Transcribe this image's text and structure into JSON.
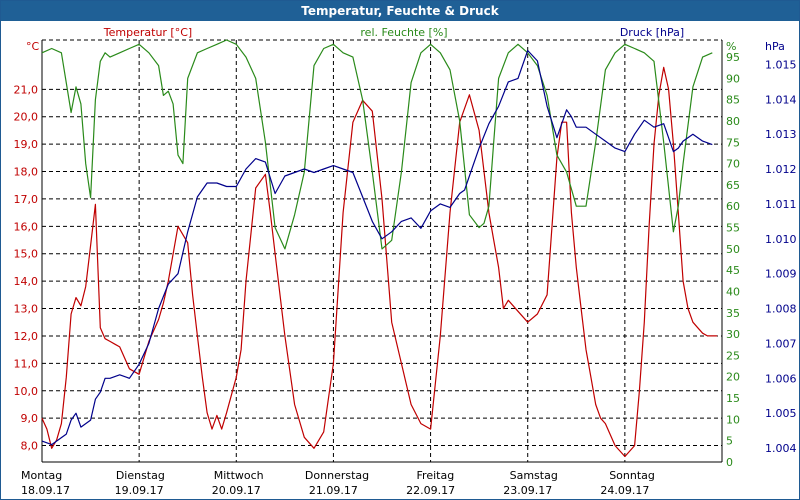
{
  "chart_data": {
    "type": "line",
    "title": "Temperatur, Feuchte & Druck",
    "x_categories": [
      {
        "day": "Montag",
        "date": "18.09.17"
      },
      {
        "day": "Dienstag",
        "date": "19.09.17"
      },
      {
        "day": "Mittwoch",
        "date": "20.09.17"
      },
      {
        "day": "Donnerstag",
        "date": "21.09.17"
      },
      {
        "day": "Freitag",
        "date": "22.09.17"
      },
      {
        "day": "Samstag",
        "date": "23.09.17"
      },
      {
        "day": "Sonntag",
        "date": "24.09.17"
      }
    ],
    "x_range_days": [
      0,
      7
    ],
    "grid": true,
    "axes": {
      "temperature": {
        "label": "Temperatur [°C]",
        "unit": "°C",
        "min": 7.4,
        "max": 22.8,
        "ticks": [
          "8,0",
          "9,0",
          "10,0",
          "11,0",
          "12,0",
          "13,0",
          "14,0",
          "15,0",
          "16,0",
          "17,0",
          "18,0",
          "19,0",
          "20,0",
          "21,0"
        ],
        "tick_values": [
          8,
          9,
          10,
          11,
          12,
          13,
          14,
          15,
          16,
          17,
          18,
          19,
          20,
          21
        ],
        "color": "#c00000"
      },
      "humidity": {
        "label": "rel. Feuchte [%]",
        "unit": "%",
        "min": 0,
        "max": 99,
        "ticks": [
          "0",
          "5",
          "10",
          "15",
          "20",
          "25",
          "30",
          "35",
          "40",
          "45",
          "50",
          "55",
          "60",
          "65",
          "70",
          "75",
          "80",
          "85",
          "90",
          "95"
        ],
        "tick_values": [
          0,
          5,
          10,
          15,
          20,
          25,
          30,
          35,
          40,
          45,
          50,
          55,
          60,
          65,
          70,
          75,
          80,
          85,
          90,
          95
        ],
        "color": "#2a8a1a"
      },
      "pressure": {
        "label": "Druck [hPa]",
        "unit": "hPa",
        "min": 1003.6,
        "max": 1015.7,
        "ticks": [
          "1.004",
          "1.005",
          "1.006",
          "1.007",
          "1.008",
          "1.009",
          "1.010",
          "1.011",
          "1.012",
          "1.013",
          "1.014",
          "1.015"
        ],
        "tick_values": [
          1004,
          1005,
          1006,
          1007,
          1008,
          1009,
          1010,
          1011,
          1012,
          1013,
          1014,
          1015
        ],
        "color": "#00008b"
      }
    },
    "series": [
      {
        "name": "Temperatur [°C]",
        "axis": "temperature",
        "color": "#c00000",
        "x": [
          0,
          0.05,
          0.1,
          0.15,
          0.2,
          0.25,
          0.3,
          0.35,
          0.4,
          0.45,
          0.5,
          0.55,
          0.6,
          0.65,
          0.7,
          0.75,
          0.8,
          0.9,
          1.0,
          1.1,
          1.2,
          1.25,
          1.3,
          1.4,
          1.5,
          1.55,
          1.6,
          1.65,
          1.7,
          1.75,
          1.8,
          1.85,
          1.9,
          2.0,
          2.05,
          2.1,
          2.2,
          2.3,
          2.35,
          2.4,
          2.5,
          2.6,
          2.7,
          2.8,
          2.9,
          3.0,
          3.1,
          3.2,
          3.3,
          3.4,
          3.5,
          3.6,
          3.7,
          3.8,
          3.9,
          4.0,
          4.1,
          4.2,
          4.3,
          4.4,
          4.5,
          4.6,
          4.65,
          4.7,
          4.75,
          4.8,
          4.9,
          5.0,
          5.1,
          5.2,
          5.3,
          5.35,
          5.4,
          5.45,
          5.5,
          5.55,
          5.6,
          5.65,
          5.7,
          5.75,
          5.8,
          5.9,
          6.0,
          6.1,
          6.15,
          6.2,
          6.25,
          6.3,
          6.35,
          6.4,
          6.45,
          6.5,
          6.55,
          6.6,
          6.65,
          6.7,
          6.75,
          6.8,
          6.85,
          6.9,
          6.95
        ],
        "y": [
          9.0,
          8.6,
          7.9,
          8.2,
          8.8,
          10.5,
          12.8,
          13.4,
          13.1,
          13.8,
          15.3,
          16.8,
          12.3,
          11.9,
          11.8,
          11.7,
          11.6,
          10.8,
          10.6,
          11.8,
          12.6,
          13.2,
          14.0,
          16.0,
          15.4,
          13.5,
          12.0,
          10.5,
          9.2,
          8.6,
          9.1,
          8.6,
          9.2,
          10.5,
          11.5,
          14.0,
          17.4,
          17.9,
          16.5,
          15.0,
          12.0,
          9.5,
          8.3,
          7.9,
          8.5,
          11.0,
          16.5,
          19.8,
          20.6,
          20.2,
          17.0,
          12.5,
          11.0,
          9.5,
          8.8,
          8.6,
          12.0,
          16.5,
          19.8,
          20.8,
          19.5,
          16.5,
          15.5,
          14.5,
          13.0,
          13.3,
          12.9,
          12.5,
          12.8,
          13.5,
          18.5,
          19.8,
          19.8,
          16.5,
          14.5,
          13.0,
          11.5,
          10.5,
          9.5,
          9.0,
          8.8,
          8.0,
          7.6,
          8.0,
          10.0,
          12.5,
          16.0,
          19.0,
          20.8,
          21.8,
          21.0,
          19.0,
          16.5,
          14.0,
          13.0,
          12.5,
          12.3,
          12.1,
          12.0,
          12.0,
          12.0
        ]
      },
      {
        "name": "rel. Feuchte [%]",
        "axis": "humidity",
        "color": "#2a8a1a",
        "x": [
          0,
          0.1,
          0.2,
          0.3,
          0.35,
          0.4,
          0.45,
          0.5,
          0.55,
          0.6,
          0.65,
          0.7,
          0.8,
          0.9,
          1.0,
          1.1,
          1.2,
          1.25,
          1.3,
          1.35,
          1.4,
          1.45,
          1.5,
          1.6,
          1.7,
          1.8,
          1.9,
          2.0,
          2.1,
          2.2,
          2.3,
          2.4,
          2.5,
          2.6,
          2.7,
          2.8,
          2.9,
          3.0,
          3.1,
          3.2,
          3.3,
          3.4,
          3.5,
          3.6,
          3.7,
          3.8,
          3.9,
          4.0,
          4.1,
          4.2,
          4.3,
          4.4,
          4.5,
          4.55,
          4.6,
          4.65,
          4.7,
          4.8,
          4.9,
          5.0,
          5.1,
          5.2,
          5.3,
          5.4,
          5.5,
          5.6,
          5.7,
          5.8,
          5.9,
          6.0,
          6.1,
          6.2,
          6.3,
          6.4,
          6.5,
          6.55,
          6.6,
          6.7,
          6.8,
          6.9
        ],
        "y": [
          96,
          97,
          96,
          82,
          88,
          84,
          70,
          62,
          85,
          94,
          96,
          95,
          96,
          97,
          98,
          96,
          93,
          86,
          87,
          84,
          72,
          70,
          90,
          96,
          97,
          98,
          99,
          98,
          95,
          90,
          75,
          55,
          50,
          58,
          68,
          93,
          97,
          98,
          96,
          95,
          85,
          68,
          50,
          52,
          68,
          89,
          96,
          98,
          96,
          92,
          80,
          58,
          55,
          56,
          60,
          75,
          90,
          96,
          98,
          96,
          93,
          86,
          72,
          68,
          60,
          60,
          75,
          92,
          96,
          98,
          97,
          96,
          94,
          75,
          54,
          60,
          70,
          88,
          95,
          96
        ]
      },
      {
        "name": "Druck [hPa]",
        "axis": "pressure",
        "color": "#00008b",
        "x": [
          0,
          0.1,
          0.2,
          0.25,
          0.3,
          0.35,
          0.4,
          0.5,
          0.55,
          0.6,
          0.65,
          0.7,
          0.8,
          0.9,
          1.0,
          1.1,
          1.2,
          1.3,
          1.4,
          1.5,
          1.6,
          1.7,
          1.8,
          1.9,
          2.0,
          2.1,
          2.2,
          2.3,
          2.4,
          2.5,
          2.6,
          2.7,
          2.8,
          2.9,
          3.0,
          3.1,
          3.2,
          3.3,
          3.4,
          3.5,
          3.6,
          3.7,
          3.8,
          3.9,
          4.0,
          4.1,
          4.2,
          4.3,
          4.35,
          4.4,
          4.5,
          4.6,
          4.7,
          4.8,
          4.9,
          5.0,
          5.1,
          5.2,
          5.3,
          5.4,
          5.45,
          5.5,
          5.6,
          5.7,
          5.8,
          5.9,
          6.0,
          6.1,
          6.2,
          6.3,
          6.4,
          6.5,
          6.55,
          6.6,
          6.7,
          6.8,
          6.9
        ],
        "y": [
          1004.2,
          1004.1,
          1004.3,
          1004.4,
          1004.8,
          1005.0,
          1004.6,
          1004.8,
          1005.4,
          1005.6,
          1006.0,
          1006.0,
          1006.1,
          1006.0,
          1006.4,
          1007.0,
          1008.0,
          1008.7,
          1009.0,
          1010.2,
          1011.2,
          1011.6,
          1011.6,
          1011.5,
          1011.5,
          1012.0,
          1012.3,
          1012.2,
          1011.3,
          1011.8,
          1011.9,
          1012.0,
          1011.9,
          1012.0,
          1012.1,
          1012.0,
          1011.9,
          1011.2,
          1010.5,
          1010.0,
          1010.2,
          1010.5,
          1010.6,
          1010.3,
          1010.8,
          1011.0,
          1010.9,
          1011.3,
          1011.4,
          1011.8,
          1012.6,
          1013.3,
          1013.8,
          1014.5,
          1014.6,
          1015.4,
          1015.1,
          1013.8,
          1012.9,
          1013.7,
          1013.5,
          1013.2,
          1013.2,
          1013.0,
          1012.8,
          1012.6,
          1012.5,
          1013.0,
          1013.4,
          1013.2,
          1013.3,
          1012.5,
          1012.6,
          1012.8,
          1013.0,
          1012.8,
          1012.7
        ]
      }
    ]
  }
}
